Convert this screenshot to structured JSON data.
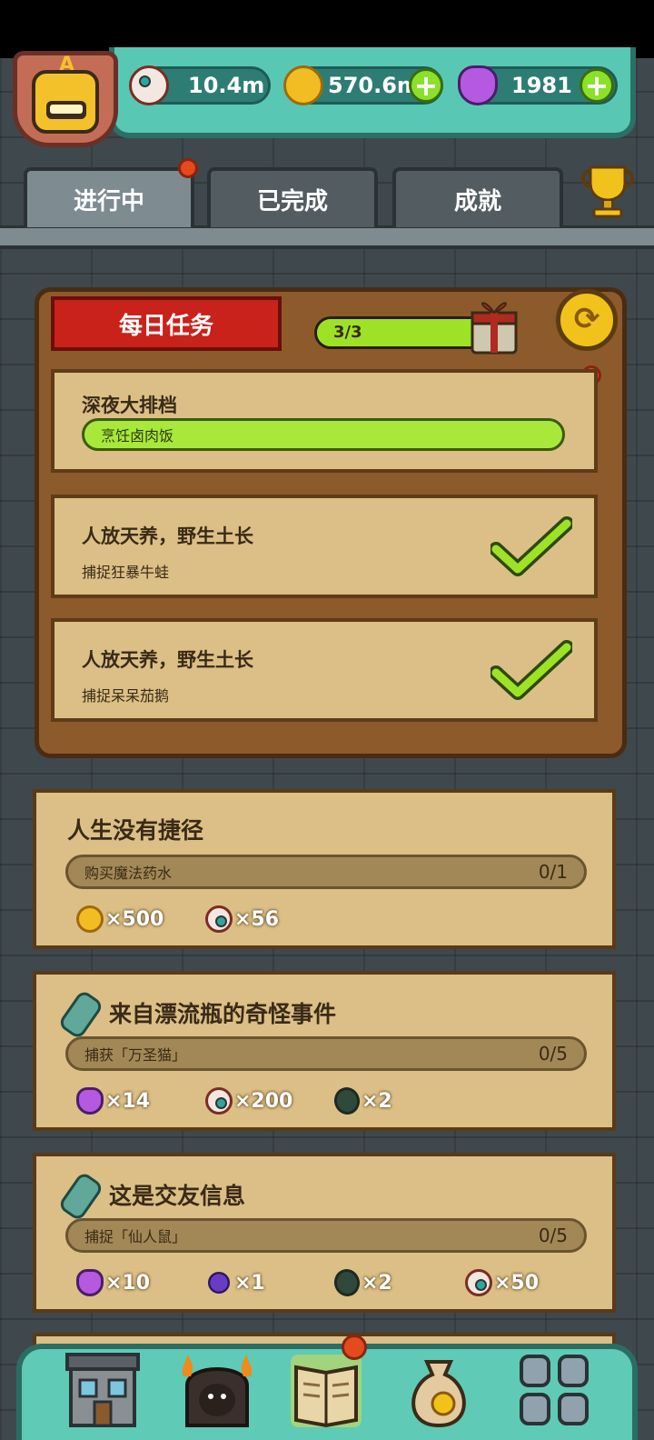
{
  "resources": {
    "eyes": "10.4m",
    "coins": "570.6m",
    "potions": "1981",
    "add_symbol": "+"
  },
  "avatar": {
    "letter": "A"
  },
  "tabs": [
    {
      "label": "进行中",
      "active": true,
      "has_notification": true
    },
    {
      "label": "已完成",
      "active": false
    },
    {
      "label": "成就",
      "active": false
    }
  ],
  "daily": {
    "banner": "每日任务",
    "progress_text": "3/3",
    "progress_fraction": 1.0,
    "refresh_symbol": "⟳",
    "tasks": [
      {
        "title": "深夜大排档",
        "subtitle": "烹饪卤肉饭",
        "done": false
      },
      {
        "title": "人放天养，野生土长",
        "subtitle": "捕捉狂暴牛蛙",
        "done": true
      },
      {
        "title": "人放天养，野生土长",
        "subtitle": "捕捉呆呆茄鹅",
        "done": true
      }
    ]
  },
  "quests": [
    {
      "title": "人生没有捷径",
      "task": "购买魔法药水",
      "progress": "0/1",
      "rewards": [
        {
          "icon": "coin-icon",
          "amount": "×500"
        },
        {
          "icon": "eye-icon",
          "amount": "×56"
        }
      ]
    },
    {
      "title": "来自漂流瓶的奇怪事件",
      "task": "捕获「万圣猫」",
      "progress": "0/5",
      "rewards": [
        {
          "icon": "potion-icon",
          "amount": "×14"
        },
        {
          "icon": "eye-icon",
          "amount": "×200"
        },
        {
          "icon": "card-icon",
          "amount": "×2"
        }
      ]
    },
    {
      "title": "这是交友信息",
      "task": "捕捉「仙人鼠」",
      "progress": "0/5",
      "rewards": [
        {
          "icon": "potion-icon",
          "amount": "×10"
        },
        {
          "icon": "crystal-icon",
          "amount": "×1"
        },
        {
          "icon": "card-icon",
          "amount": "×2"
        },
        {
          "icon": "eye-icon",
          "amount": "×50"
        }
      ]
    }
  ],
  "bottom_nav": [
    {
      "icon": "shop-building-icon"
    },
    {
      "icon": "monster-furnace-icon"
    },
    {
      "icon": "quest-book-icon",
      "active": true,
      "has_notification": true
    },
    {
      "icon": "money-bag-icon"
    },
    {
      "icon": "grid-menu-icon"
    }
  ],
  "colors": {
    "teal": "#58c8b4",
    "wood": "#8d5a2c",
    "paper": "#dcbf86",
    "green": "#9de226",
    "red": "#c8221b"
  }
}
